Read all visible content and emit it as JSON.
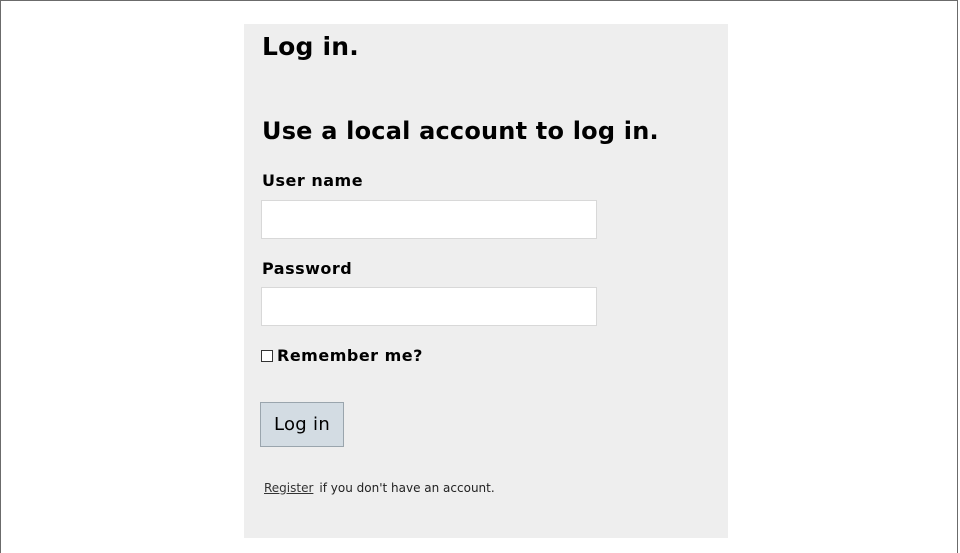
{
  "header": {
    "page_title": "Log in.",
    "section_title": "Use a local account to log in."
  },
  "form": {
    "username_label": "User name",
    "username_value": "",
    "password_label": "Password",
    "password_value": "",
    "remember_label": "Remember me?",
    "remember_checked": false,
    "submit_label": "Log in"
  },
  "footer": {
    "register_link": "Register",
    "register_suffix": "if you don't have an account."
  },
  "colors": {
    "panel_background": "#eeeeee",
    "button_background": "#d3dce3",
    "input_background": "#ffffff"
  }
}
